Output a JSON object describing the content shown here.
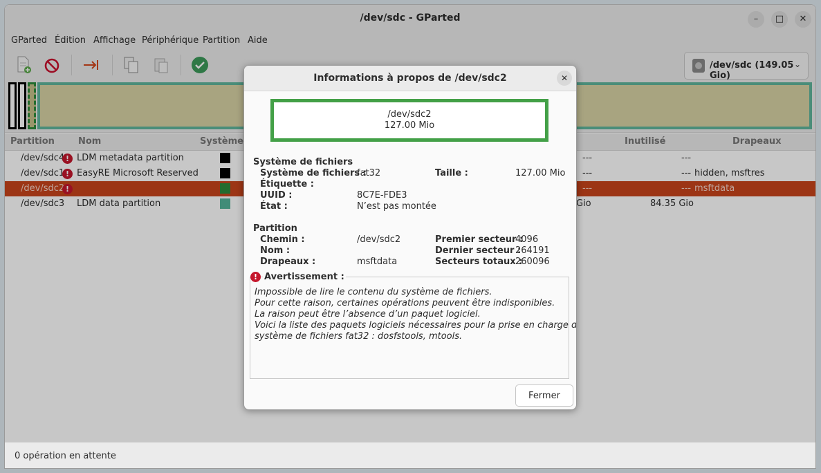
{
  "window": {
    "title": "/dev/sdc - GParted",
    "minimize": "–",
    "maximize": "□",
    "close": "✕"
  },
  "menu": [
    "GParted",
    "Édition",
    "Affichage",
    "Périphérique",
    "Partition",
    "Aide"
  ],
  "device_selector": "/dev/sdc (149.05 Gio)",
  "table": {
    "headers": [
      "Partition",
      "Nom",
      "Système de fichiers",
      "Inutilisé",
      "Drapeaux"
    ],
    "rows": [
      {
        "partition": "/dev/sdc4",
        "name": "LDM metadata partition",
        "fs_color": "#000000",
        "size": "---",
        "used": "---",
        "unused": "---",
        "flags": ""
      },
      {
        "partition": "/dev/sdc1",
        "name": "EasyRE Microsoft Reserved",
        "fs_color": "#000000",
        "size": "---",
        "used": "---",
        "unused": "---",
        "flags": "hidden, msftres"
      },
      {
        "partition": "/dev/sdc2",
        "name": "",
        "fs_color": "#2e8b3c",
        "size": "---",
        "used": "---",
        "unused": "---",
        "flags": "msftdata"
      },
      {
        "partition": "/dev/sdc3",
        "name": "LDM data partition",
        "fs_color": "#54b49a",
        "size": "Gio",
        "used": "84.35 Gio",
        "unused": "",
        "flags": ""
      }
    ]
  },
  "status": "0 opération en attente",
  "dialog": {
    "title": "Informations à propos de /dev/sdc2",
    "graph_name": "/dev/sdc2",
    "graph_size": "127.00 Mio",
    "fs_section": "Système de fichiers",
    "fs_label": "Système de fichiers :",
    "fs_value": "fat32",
    "size_label": "Taille :",
    "size_value": "127.00 Mio",
    "label_label": "Étiquette :",
    "uuid_label": "UUID :",
    "uuid_value": "8C7E-FDE3",
    "state_label": "État :",
    "state_value": "N’est pas montée",
    "part_section": "Partition",
    "path_label": "Chemin :",
    "path_value": "/dev/sdc2",
    "first_label": "Premier secteur :",
    "first_value": "4096",
    "name_label": "Nom :",
    "last_label": "Dernier secteur :",
    "last_value": "264191",
    "flags_label": "Drapeaux :",
    "flags_value": "msftdata",
    "total_label": "Secteurs totaux :",
    "total_value": "260096",
    "warning_title": "Avertissement :",
    "warning_lines": [
      "Impossible de lire le contenu du système de fichiers.",
      "Pour cette raison, certaines opérations peuvent être indisponibles.",
      "La raison peut être l’absence d’un paquet logiciel.",
      "Voici la liste des paquets logiciels nécessaires pour la prise en charge du",
      "système de fichiers fat32 : dosfstools, mtools."
    ],
    "close_button": "Fermer"
  }
}
